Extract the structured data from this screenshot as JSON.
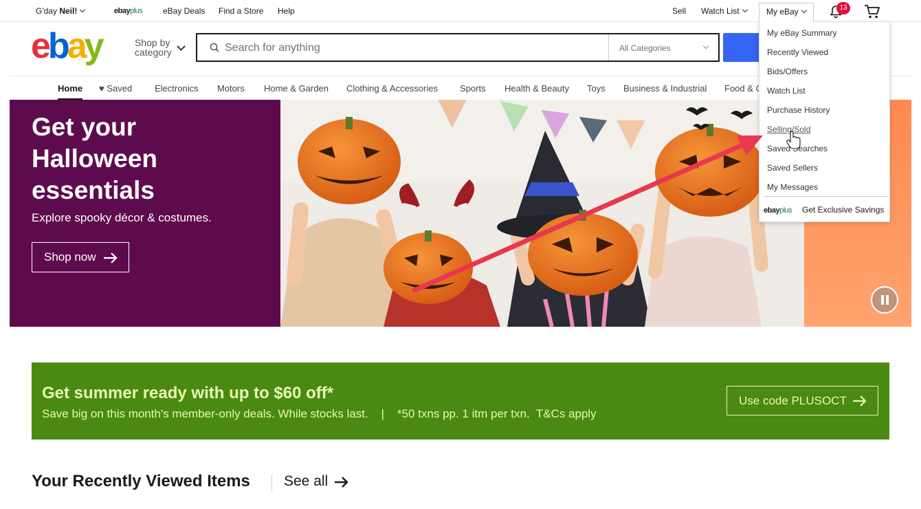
{
  "topbar": {
    "greeting": "G'day ",
    "user": "Neil!",
    "ebayplus": {
      "ebay": "ebay",
      "plus": "plus"
    },
    "deals": "eBay Deals",
    "find_store": "Find a Store",
    "help": "Help",
    "sell": "Sell",
    "watch_list": "Watch List",
    "my_ebay": "My eBay",
    "notification_count": "13"
  },
  "header": {
    "shop_by_line1": "Shop by",
    "shop_by_line2": "category",
    "search_placeholder": "Search for anything",
    "category_select": "All Categories"
  },
  "nav": [
    "Home",
    "Saved",
    "Electronics",
    "Motors",
    "Home & Garden",
    "Clothing & Accessories",
    "Sports",
    "Health & Beauty",
    "Toys",
    "Business & Industrial",
    "Food & C"
  ],
  "hero": {
    "title": "Get your Halloween essentials",
    "subtitle": "Explore spooky décor & costumes.",
    "cta": "Shop now"
  },
  "promo": {
    "title": "Get summer ready with up to $60 off*",
    "subtitle": "Save big on this month's member-only deals. While stocks last.    |    *50 txns pp. 1 itm per txn.  T&Cs apply",
    "cta": "Use code PLUSOCT"
  },
  "recently_viewed": {
    "title": "Your Recently Viewed Items",
    "see_all": "See all"
  },
  "my_ebay_menu": {
    "items": [
      "My eBay Summary",
      "Recently Viewed",
      "Bids/Offers",
      "Watch List",
      "Purchase History",
      "Selling/Sold",
      "Saved Searches",
      "Saved Sellers",
      "My Messages"
    ],
    "hovered": "Selling/Sold",
    "footer_brand": {
      "ebay": "ebay",
      "plus": "plus"
    },
    "footer_text": "Get Exclusive Savings"
  },
  "colors": {
    "hero_purple": "#5e0b4e",
    "promo_green": "#4b8a12",
    "search_blue": "#3665f3",
    "annotation_red": "#e8384f"
  }
}
